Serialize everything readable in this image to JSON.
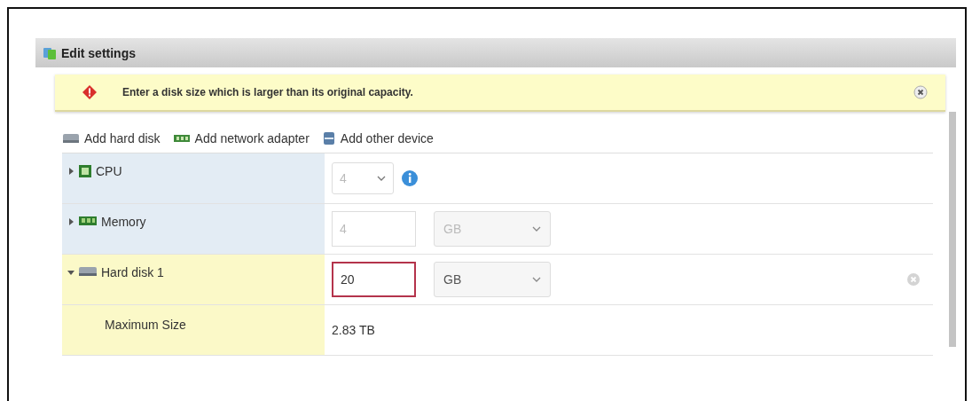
{
  "window": {
    "title": "Edit settings"
  },
  "alert": {
    "kind": "error",
    "message": "Enter a disk size which is larger than its original capacity."
  },
  "toolbar": [
    {
      "kind": "disk",
      "label": "Add hard disk"
    },
    {
      "kind": "network",
      "label": "Add network adapter"
    },
    {
      "kind": "device",
      "label": "Add other device"
    }
  ],
  "rows": [
    {
      "kind": "cpu",
      "label": "CPU",
      "expanded": false,
      "selected": false,
      "select": {
        "value": "4",
        "disabled": true
      }
    },
    {
      "kind": "memory",
      "label": "Memory",
      "expanded": false,
      "selected": false,
      "input": {
        "value": "4",
        "disabled": true,
        "invalid": false
      },
      "unit": {
        "value": "GB",
        "disabled": true
      }
    },
    {
      "kind": "disk",
      "label": "Hard disk 1",
      "expanded": true,
      "selected": true,
      "input": {
        "value": "20",
        "disabled": false,
        "invalid": true
      },
      "unit": {
        "value": "GB",
        "disabled": false
      }
    },
    {
      "kind": "detail",
      "label": "Maximum Size",
      "value": "2.83 TB",
      "selected": true
    }
  ]
}
